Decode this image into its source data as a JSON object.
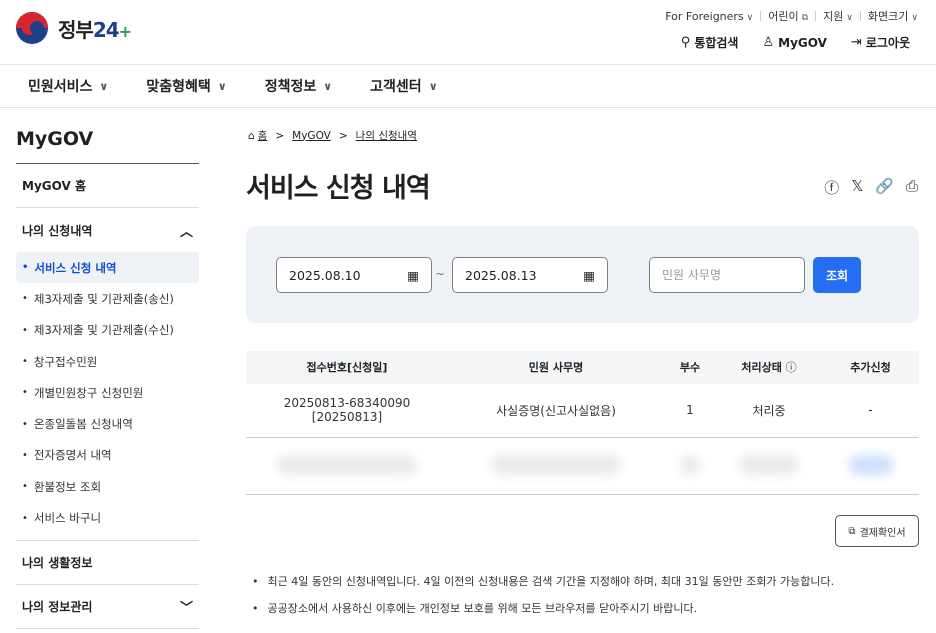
{
  "header": {
    "logo_text": "정부",
    "logo_num": "24",
    "utility": [
      "For Foreigners",
      "어린이",
      "지원",
      "화면크기"
    ],
    "actions": {
      "search": "통합검색",
      "mygov": "MyGOV",
      "logout": "로그아웃"
    }
  },
  "gnb": [
    "민원서비스",
    "맞춤형혜택",
    "정책정보",
    "고객센터"
  ],
  "sidebar": {
    "title": "MyGOV",
    "home": "MyGOV 홈",
    "section_apply": "나의 신청내역",
    "items": [
      "서비스 신청 내역",
      "제3자제출 및 기관제출(송신)",
      "제3자제출 및 기관제출(수신)",
      "창구접수민원",
      "개별민원창구 신청민원",
      "온종일돌봄 신청내역",
      "전자증명서 내역",
      "환불정보 조회",
      "서비스 바구니"
    ],
    "life": "나의 생활정보",
    "info": "나의 정보관리"
  },
  "breadcrumb": [
    "홈",
    "MyGOV",
    "나의 신청내역"
  ],
  "page": {
    "title": "서비스 신청 내역"
  },
  "search": {
    "start_date": "2025.08.10",
    "end_date": "2025.08.13",
    "tilde": "~",
    "service_placeholder": "민원 사무명",
    "button": "조회"
  },
  "table": {
    "headers": [
      "접수번호[신청일]",
      "민원 사무명",
      "부수",
      "처리상태",
      "추가신청"
    ],
    "rows": [
      {
        "receipt_no": "20250813-68340090",
        "date": "[20250813]",
        "name": "사실증명(신고사실없음)",
        "copies": "1",
        "status": "처리중",
        "extra": "-"
      }
    ]
  },
  "receipt_button": "결제확인서",
  "notes": [
    "최근 4일 동안의 신청내역입니다. 4일 이전의 신청내용은 검색 기간을 지정해야 하며, 최대 31일 동안만 조회가 가능합니다.",
    "공공장소에서 사용하신 이후에는 개인정보 보호를 위해 모든 브라우저를 닫아주시기 바랍니다."
  ]
}
